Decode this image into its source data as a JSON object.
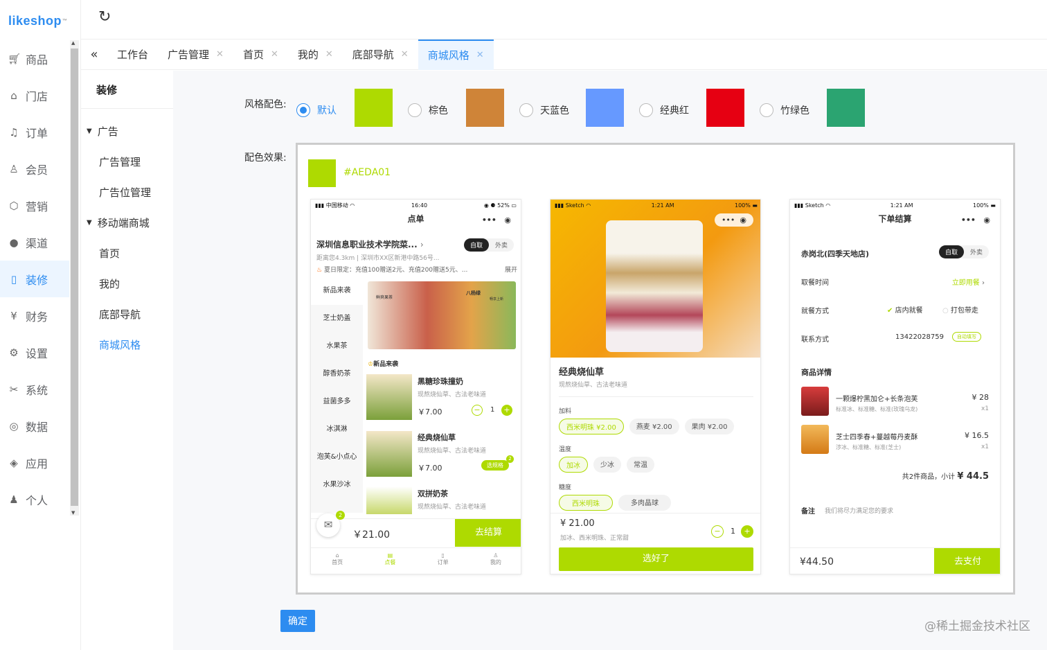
{
  "logo": "likeshop",
  "logo_tm": "™",
  "nav": [
    {
      "label": "商品",
      "icon": "cart-icon"
    },
    {
      "label": "门店",
      "icon": "home-icon"
    },
    {
      "label": "订单",
      "icon": "bell-icon"
    },
    {
      "label": "会员",
      "icon": "user-icon"
    },
    {
      "label": "营销",
      "icon": "cube-icon"
    },
    {
      "label": "渠道",
      "icon": "compass-icon"
    },
    {
      "label": "装修",
      "icon": "mobile-icon"
    },
    {
      "label": "财务",
      "icon": "yen-icon"
    },
    {
      "label": "设置",
      "icon": "gear-icon"
    },
    {
      "label": "系统",
      "icon": "tools-icon"
    },
    {
      "label": "数据",
      "icon": "globe-icon"
    },
    {
      "label": "应用",
      "icon": "shield-icon"
    },
    {
      "label": "个人",
      "icon": "person-icon"
    }
  ],
  "tabs": [
    "工作台",
    "广告管理",
    "首页",
    "我的",
    "底部导航",
    "商城风格"
  ],
  "sub": {
    "title": "装修",
    "ad_group": "广告",
    "ad_items": [
      "广告管理",
      "广告位管理"
    ],
    "mobile_group": "移动端商城",
    "mobile_items": [
      "首页",
      "我的",
      "底部导航",
      "商城风格"
    ]
  },
  "style": {
    "label": "风格配色:",
    "options": [
      {
        "name": "默认",
        "color": "#AEDA01"
      },
      {
        "name": "棕色",
        "color": "#CF8438"
      },
      {
        "name": "天蓝色",
        "color": "#6699FF"
      },
      {
        "name": "经典红",
        "color": "#E60012"
      },
      {
        "name": "竹绿色",
        "color": "#2BA471"
      }
    ],
    "effect_label": "配色效果:",
    "hex": "#AEDA01"
  },
  "p1": {
    "carrier": "中国移动",
    "time": "16:40",
    "battery": "52%",
    "title": "点单",
    "store": "深圳信息职业技术学院菜...",
    "pick": "自取",
    "deliver": "外卖",
    "dist": "距离您4.3km",
    "addr": "深圳市XX区新港中路56号...",
    "promo": "夏日限定：充值100赠送2元、充值200赠送5元、...",
    "expand": "展开",
    "cats": [
      "新品来袭",
      "芝士奶盖",
      "水果茶",
      "醇香奶茶",
      "益菌多多",
      "冰淇淋",
      "泡芙&小点心",
      "水果沙冰"
    ],
    "banner1": "鲜爽果茶",
    "banner2": "八杨绿",
    "banner3": "畅享上新",
    "section": "新品来袭",
    "items": [
      {
        "name": "黑糖珍珠撞奶",
        "desc": "现熬烧仙草、古法老味道",
        "price": "￥7.00",
        "qty": "1"
      },
      {
        "name": "经典烧仙草",
        "desc": "现熬烧仙草、古法老味道",
        "price": "￥7.00",
        "spec": "选规格",
        "badge": "2"
      },
      {
        "name": "双拼奶茶",
        "desc": "现熬烧仙草、古法老味道"
      }
    ],
    "cart_badge": "2",
    "total": "￥21.00",
    "checkout": "去结算",
    "bottom": [
      "首页",
      "点餐",
      "订单",
      "我的"
    ]
  },
  "p2": {
    "carrier": "Sketch",
    "time": "1:21 AM",
    "battery": "100%",
    "name": "经典烧仙草",
    "desc": "现熬烧仙草、古法老味道",
    "add_label": "加料",
    "adds": [
      "西米明珠 ¥2.00",
      "燕麦 ¥2.00",
      "果肉 ¥2.00"
    ],
    "temp_label": "温度",
    "temps": [
      "加冰",
      "少冰",
      "常温"
    ],
    "sweet_label": "糖度",
    "sweets": [
      "西米明珠",
      "多肉晶球"
    ],
    "price": "¥ 21.00",
    "spec": "加冰、西米明珠、正常甜",
    "qty": "1",
    "btn": "选好了"
  },
  "p3": {
    "carrier": "Sketch",
    "time": "1:21 AM",
    "battery": "100%",
    "title": "下单结算",
    "store": "赤岗北(四季天地店)",
    "pick": "自取",
    "deliver": "外卖",
    "time_label": "取餐时间",
    "time_val": "立即用餐",
    "dine_label": "就餐方式",
    "dine_in": "店内就餐",
    "takeout": "打包带走",
    "contact_label": "联系方式",
    "phone": "13422028759",
    "auto": "自动填写",
    "goods_label": "商品详情",
    "goods": [
      {
        "name": "一颗爆柠黑加仑+长条泡芙",
        "spec": "标准冰、标准糖、标准(玫瑰乌龙)",
        "price": "¥ 28",
        "qty": "x1"
      },
      {
        "name": "芝士四季春+蔓越莓丹麦酥",
        "spec": "涉冰、标准糖、标准(芝士)",
        "price": "¥ 16.5",
        "qty": "x1"
      }
    ],
    "summary_prefix": "共2件商品，小计",
    "summary_amount": "¥ 44.5",
    "note_label": "备注",
    "note": "我们将尽力满足您的要求",
    "total": "¥44.50",
    "pay": "去支付"
  },
  "confirm": "确定",
  "watermark": "@稀土掘金技术社区"
}
